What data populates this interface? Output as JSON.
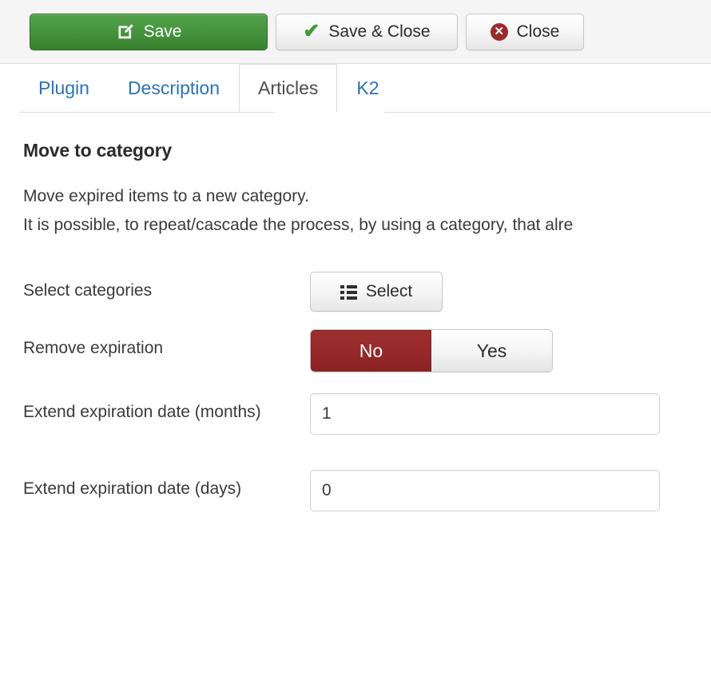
{
  "toolbar": {
    "save": {
      "label": "Save",
      "icon": "edit-pencil-icon"
    },
    "save_close": {
      "label": "Save & Close",
      "icon": "check-icon"
    },
    "close": {
      "label": "Close",
      "icon": "close-circle-icon"
    }
  },
  "tabs": [
    {
      "label": "Plugin",
      "active": false
    },
    {
      "label": "Description",
      "active": false
    },
    {
      "label": "Articles",
      "active": true
    },
    {
      "label": "K2",
      "active": false
    }
  ],
  "main": {
    "section_title": "Move to category",
    "description": "Move expired items to a new category.\nIt is possible, to repeat/cascade the process, by using a category, that alre",
    "fields": {
      "select_categories": {
        "label": "Select categories",
        "button_label": "Select"
      },
      "remove_expiration": {
        "label": "Remove expiration",
        "option_no": "No",
        "option_yes": "Yes",
        "selected": "No"
      },
      "extend_months": {
        "label": "Extend expiration date (months)",
        "value": "1"
      },
      "extend_days": {
        "label": "Extend expiration date (days)",
        "value": "0"
      }
    }
  },
  "colors": {
    "save_green": "#469540",
    "toggle_active_red": "#97292a",
    "tab_link_blue": "#2b72b4",
    "close_icon_red": "#9d2a2a"
  }
}
